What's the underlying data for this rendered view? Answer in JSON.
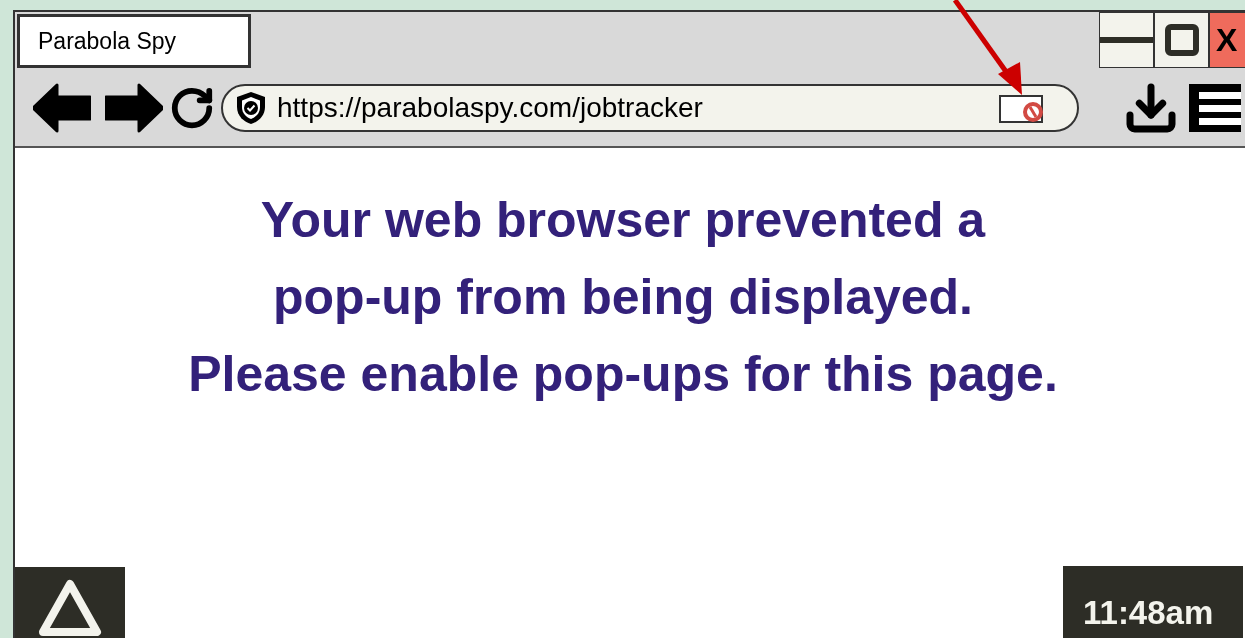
{
  "window": {
    "tab_title": "Parabola Spy",
    "close_label": "X"
  },
  "address_bar": {
    "url": "https://parabolaspy.com/jobtracker"
  },
  "message": "Your web browser prevented a\npop-up from being displayed.\nPlease enable pop-ups for this page.",
  "taskbar": {
    "clock": "11:48am"
  }
}
